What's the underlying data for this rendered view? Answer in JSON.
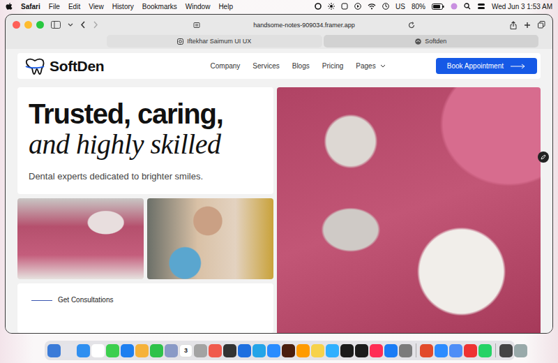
{
  "menubar": {
    "app": "Safari",
    "menus": [
      "File",
      "Edit",
      "View",
      "History",
      "Bookmarks",
      "Window",
      "Help"
    ],
    "input": "US",
    "battery": "80%",
    "clock": "Wed Jun 3  1:53 AM"
  },
  "browser": {
    "url": "handsome-notes-909034.framer.app",
    "tabs": [
      {
        "label": "Iftekhar Saimum UI UX",
        "selected": false
      },
      {
        "label": "Softden",
        "selected": true
      }
    ]
  },
  "site": {
    "logo": "SoftDen",
    "nav": [
      "Company",
      "Services",
      "Blogs",
      "Pricing",
      "Pages"
    ],
    "cta": "Book Appointment",
    "title_line1": "Trusted, caring,",
    "title_line2": "and highly skilled",
    "subtitle": "Dental experts dedicated to brighter smiles.",
    "consult": "Get Consultations"
  },
  "dock": {
    "calendar_day": "3"
  }
}
